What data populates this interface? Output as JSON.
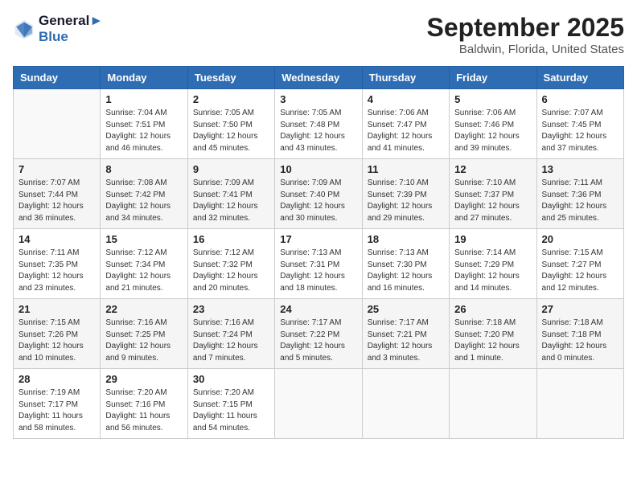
{
  "logo": {
    "line1": "General",
    "line2": "Blue"
  },
  "title": "September 2025",
  "subtitle": "Baldwin, Florida, United States",
  "days_of_week": [
    "Sunday",
    "Monday",
    "Tuesday",
    "Wednesday",
    "Thursday",
    "Friday",
    "Saturday"
  ],
  "weeks": [
    [
      {
        "day": "",
        "info": ""
      },
      {
        "day": "1",
        "info": "Sunrise: 7:04 AM\nSunset: 7:51 PM\nDaylight: 12 hours\nand 46 minutes."
      },
      {
        "day": "2",
        "info": "Sunrise: 7:05 AM\nSunset: 7:50 PM\nDaylight: 12 hours\nand 45 minutes."
      },
      {
        "day": "3",
        "info": "Sunrise: 7:05 AM\nSunset: 7:48 PM\nDaylight: 12 hours\nand 43 minutes."
      },
      {
        "day": "4",
        "info": "Sunrise: 7:06 AM\nSunset: 7:47 PM\nDaylight: 12 hours\nand 41 minutes."
      },
      {
        "day": "5",
        "info": "Sunrise: 7:06 AM\nSunset: 7:46 PM\nDaylight: 12 hours\nand 39 minutes."
      },
      {
        "day": "6",
        "info": "Sunrise: 7:07 AM\nSunset: 7:45 PM\nDaylight: 12 hours\nand 37 minutes."
      }
    ],
    [
      {
        "day": "7",
        "info": "Sunrise: 7:07 AM\nSunset: 7:44 PM\nDaylight: 12 hours\nand 36 minutes."
      },
      {
        "day": "8",
        "info": "Sunrise: 7:08 AM\nSunset: 7:42 PM\nDaylight: 12 hours\nand 34 minutes."
      },
      {
        "day": "9",
        "info": "Sunrise: 7:09 AM\nSunset: 7:41 PM\nDaylight: 12 hours\nand 32 minutes."
      },
      {
        "day": "10",
        "info": "Sunrise: 7:09 AM\nSunset: 7:40 PM\nDaylight: 12 hours\nand 30 minutes."
      },
      {
        "day": "11",
        "info": "Sunrise: 7:10 AM\nSunset: 7:39 PM\nDaylight: 12 hours\nand 29 minutes."
      },
      {
        "day": "12",
        "info": "Sunrise: 7:10 AM\nSunset: 7:37 PM\nDaylight: 12 hours\nand 27 minutes."
      },
      {
        "day": "13",
        "info": "Sunrise: 7:11 AM\nSunset: 7:36 PM\nDaylight: 12 hours\nand 25 minutes."
      }
    ],
    [
      {
        "day": "14",
        "info": "Sunrise: 7:11 AM\nSunset: 7:35 PM\nDaylight: 12 hours\nand 23 minutes."
      },
      {
        "day": "15",
        "info": "Sunrise: 7:12 AM\nSunset: 7:34 PM\nDaylight: 12 hours\nand 21 minutes."
      },
      {
        "day": "16",
        "info": "Sunrise: 7:12 AM\nSunset: 7:32 PM\nDaylight: 12 hours\nand 20 minutes."
      },
      {
        "day": "17",
        "info": "Sunrise: 7:13 AM\nSunset: 7:31 PM\nDaylight: 12 hours\nand 18 minutes."
      },
      {
        "day": "18",
        "info": "Sunrise: 7:13 AM\nSunset: 7:30 PM\nDaylight: 12 hours\nand 16 minutes."
      },
      {
        "day": "19",
        "info": "Sunrise: 7:14 AM\nSunset: 7:29 PM\nDaylight: 12 hours\nand 14 minutes."
      },
      {
        "day": "20",
        "info": "Sunrise: 7:15 AM\nSunset: 7:27 PM\nDaylight: 12 hours\nand 12 minutes."
      }
    ],
    [
      {
        "day": "21",
        "info": "Sunrise: 7:15 AM\nSunset: 7:26 PM\nDaylight: 12 hours\nand 10 minutes."
      },
      {
        "day": "22",
        "info": "Sunrise: 7:16 AM\nSunset: 7:25 PM\nDaylight: 12 hours\nand 9 minutes."
      },
      {
        "day": "23",
        "info": "Sunrise: 7:16 AM\nSunset: 7:24 PM\nDaylight: 12 hours\nand 7 minutes."
      },
      {
        "day": "24",
        "info": "Sunrise: 7:17 AM\nSunset: 7:22 PM\nDaylight: 12 hours\nand 5 minutes."
      },
      {
        "day": "25",
        "info": "Sunrise: 7:17 AM\nSunset: 7:21 PM\nDaylight: 12 hours\nand 3 minutes."
      },
      {
        "day": "26",
        "info": "Sunrise: 7:18 AM\nSunset: 7:20 PM\nDaylight: 12 hours\nand 1 minute."
      },
      {
        "day": "27",
        "info": "Sunrise: 7:18 AM\nSunset: 7:18 PM\nDaylight: 12 hours\nand 0 minutes."
      }
    ],
    [
      {
        "day": "28",
        "info": "Sunrise: 7:19 AM\nSunset: 7:17 PM\nDaylight: 11 hours\nand 58 minutes."
      },
      {
        "day": "29",
        "info": "Sunrise: 7:20 AM\nSunset: 7:16 PM\nDaylight: 11 hours\nand 56 minutes."
      },
      {
        "day": "30",
        "info": "Sunrise: 7:20 AM\nSunset: 7:15 PM\nDaylight: 11 hours\nand 54 minutes."
      },
      {
        "day": "",
        "info": ""
      },
      {
        "day": "",
        "info": ""
      },
      {
        "day": "",
        "info": ""
      },
      {
        "day": "",
        "info": ""
      }
    ]
  ]
}
